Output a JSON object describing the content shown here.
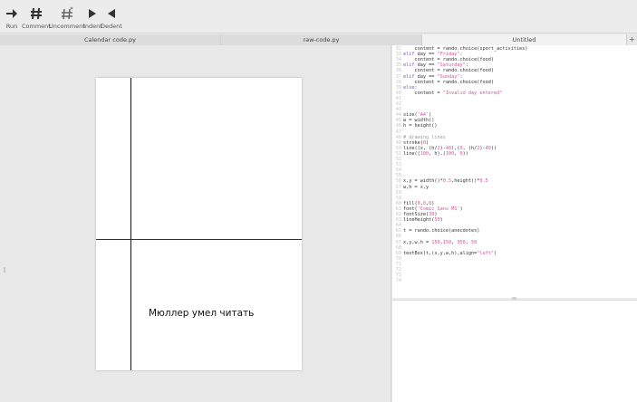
{
  "toolbar": {
    "tools": [
      {
        "label": "Run",
        "icon": "run-arrow-icon"
      },
      {
        "label": "Comment",
        "icon": "hash-icon"
      },
      {
        "label": "Uncomment",
        "icon": "hash-sparkle-icon"
      },
      {
        "label": "Indent",
        "icon": "triangle-right-icon"
      },
      {
        "label": "Dedent",
        "icon": "triangle-left-icon"
      }
    ]
  },
  "tabs": [
    {
      "label": "Calendar code.py"
    },
    {
      "label": "raw-code.py"
    },
    {
      "label": "Untitled"
    }
  ],
  "tab_add_label": "+",
  "canvas": {
    "text": "Мюллер умел читать"
  },
  "code": {
    "lines": [
      {
        "n": "32",
        "t": "    content = rando.choice(sport_activities)"
      },
      {
        "n": "33",
        "t": "elif day == \"Friday\":"
      },
      {
        "n": "34",
        "t": "    content = rando.choice(food)"
      },
      {
        "n": "35",
        "t": "elif day == \"Saturday\":"
      },
      {
        "n": "36",
        "t": "    content = rando.choice(food)"
      },
      {
        "n": "37",
        "t": "elif day == \"Sunday\":"
      },
      {
        "n": "38",
        "t": "    content = rando.choice(food)"
      },
      {
        "n": "39",
        "t": "else:"
      },
      {
        "n": "40",
        "t": "    content = \"Invalid day entered\""
      },
      {
        "n": "41",
        "t": ""
      },
      {
        "n": "42",
        "t": ""
      },
      {
        "n": "43",
        "t": ""
      },
      {
        "n": "44",
        "t": "size('A4')"
      },
      {
        "n": "45",
        "t": "w = width()"
      },
      {
        "n": "46",
        "t": "h = height()"
      },
      {
        "n": "47",
        "t": ""
      },
      {
        "n": "48",
        "t": "# drawing lines"
      },
      {
        "n": "49",
        "t": "stroke(0)"
      },
      {
        "n": "50",
        "t": "line((x, (h/2)-40),(0, (h/2)-40))"
      },
      {
        "n": "51",
        "t": "line((100, h),(100, 0))"
      },
      {
        "n": "52",
        "t": ""
      },
      {
        "n": "53",
        "t": ""
      },
      {
        "n": "54",
        "t": ""
      },
      {
        "n": "55",
        "t": ""
      },
      {
        "n": "56",
        "t": "x,y = width()*0.5,height()*0.5"
      },
      {
        "n": "57",
        "t": "w,h = x,y"
      },
      {
        "n": "58",
        "t": ""
      },
      {
        "n": "59",
        "t": ""
      },
      {
        "n": "60",
        "t": "fill(0,0,0)"
      },
      {
        "n": "61",
        "t": "font('Comic Sans MS')"
      },
      {
        "n": "62",
        "t": "fontSize(30)"
      },
      {
        "n": "63",
        "t": "lineHeight(50)"
      },
      {
        "n": "64",
        "t": ""
      },
      {
        "n": "65",
        "t": "t = rando.choice(anecdotes)"
      },
      {
        "n": "66",
        "t": ""
      },
      {
        "n": "67",
        "t": "x,y,w,h = 150,150, 350, 50"
      },
      {
        "n": "68",
        "t": ""
      },
      {
        "n": "69",
        "t": "textBox(t,(x,y,w,h),align=\"left\")"
      },
      {
        "n": "70",
        "t": ""
      },
      {
        "n": "71",
        "t": ""
      },
      {
        "n": "72",
        "t": ""
      },
      {
        "n": "73",
        "t": ""
      },
      {
        "n": "74",
        "t": ""
      }
    ]
  },
  "colors": {
    "keyword": "#7b4fd0",
    "string": "#e04ca0",
    "comment": "#999999",
    "line_number": "#c6c6c6"
  }
}
